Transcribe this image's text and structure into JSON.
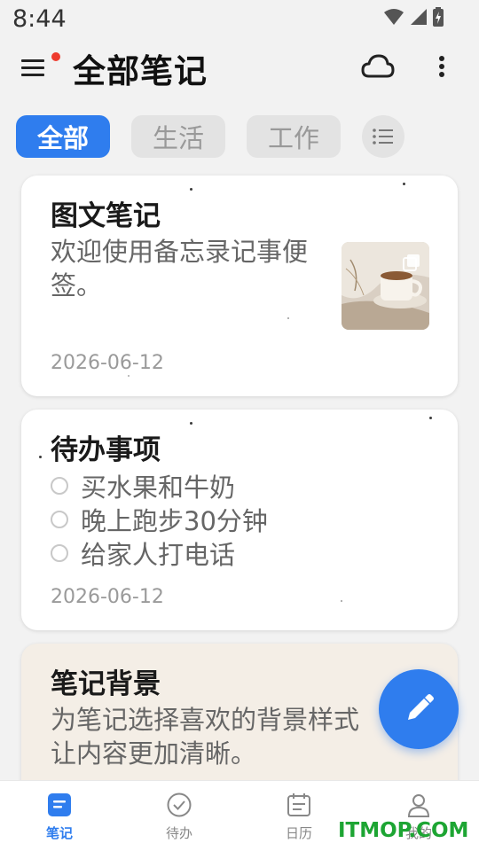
{
  "status_bar": {
    "time": "8:44"
  },
  "header": {
    "title": "全部笔记"
  },
  "tabs": [
    {
      "label": "全部",
      "active": true
    },
    {
      "label": "生活",
      "active": false
    },
    {
      "label": "工作",
      "active": false
    }
  ],
  "notes": [
    {
      "title": "图文笔记",
      "body": "欢迎使用备忘录记事便签。",
      "date": "2026-06-12"
    },
    {
      "title": "待办事项",
      "todos": [
        "买水果和牛奶",
        "晚上跑步30分钟",
        "给家人打电话"
      ],
      "date": "2026-06-12"
    },
    {
      "title": "笔记背景",
      "body_line1": "为笔记选择喜欢的背景样式",
      "body_line2": "让内容更加清晰。"
    }
  ],
  "bottom_nav": [
    {
      "label": "笔记",
      "active": true
    },
    {
      "label": "待办",
      "active": false
    },
    {
      "label": "日历",
      "active": false
    },
    {
      "label": "我的",
      "active": false
    }
  ],
  "watermark": "ITMOP.COM",
  "colors": {
    "accent": "#2f7dee",
    "notification_dot": "#ee3b2e",
    "watermark": "#1da533"
  }
}
